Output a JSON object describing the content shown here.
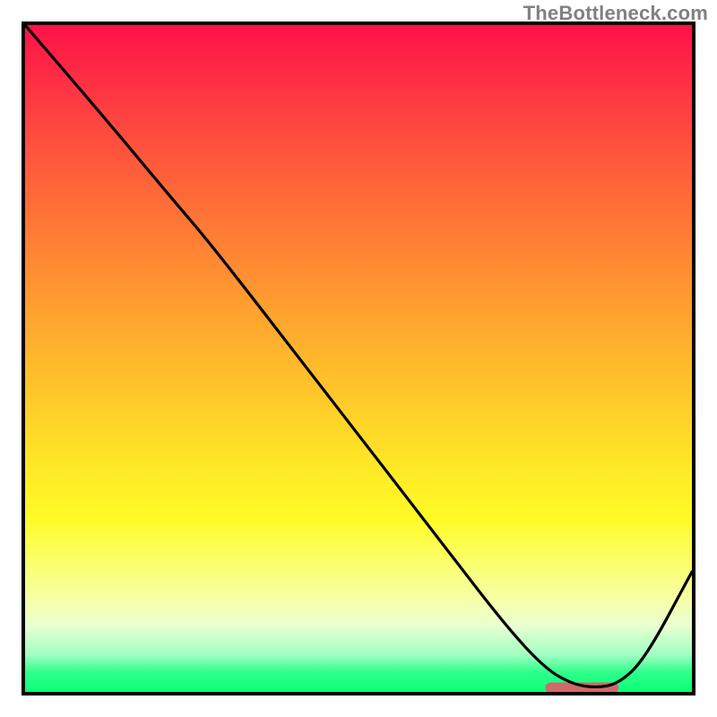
{
  "watermark": "TheBottleneck.com",
  "chart_data": {
    "type": "line",
    "title": "",
    "xlabel": "",
    "ylabel": "",
    "xlim": [
      0,
      100
    ],
    "ylim": [
      0,
      100
    ],
    "grid": false,
    "legend": false,
    "series": [
      {
        "name": "curve",
        "color": "#000000",
        "x": [
          0,
          12,
          22,
          28,
          45,
          62,
          72,
          78,
          82,
          85.5,
          89,
          93,
          100
        ],
        "values": [
          100,
          86,
          74,
          67,
          45,
          23,
          10,
          3.5,
          1.2,
          0.6,
          1.2,
          5,
          18
        ]
      }
    ],
    "marker_bar": {
      "x_start": 78,
      "x_end": 89,
      "y": 0.6,
      "color": "#cf6a6a"
    },
    "gradient_stops": [
      {
        "pos": 0.0,
        "color": "#fe1249"
      },
      {
        "pos": 0.12,
        "color": "#fe3c42"
      },
      {
        "pos": 0.25,
        "color": "#ff6839"
      },
      {
        "pos": 0.37,
        "color": "#ff8e32"
      },
      {
        "pos": 0.48,
        "color": "#ffb12d"
      },
      {
        "pos": 0.58,
        "color": "#ffcf29"
      },
      {
        "pos": 0.66,
        "color": "#fee826"
      },
      {
        "pos": 0.74,
        "color": "#fffa27"
      },
      {
        "pos": 0.8,
        "color": "#fbff65"
      },
      {
        "pos": 0.86,
        "color": "#f7ffa5"
      },
      {
        "pos": 0.9,
        "color": "#e9ffd1"
      },
      {
        "pos": 0.945,
        "color": "#9fffc1"
      },
      {
        "pos": 0.97,
        "color": "#30ff8b"
      },
      {
        "pos": 1.0,
        "color": "#0cff78"
      }
    ]
  }
}
